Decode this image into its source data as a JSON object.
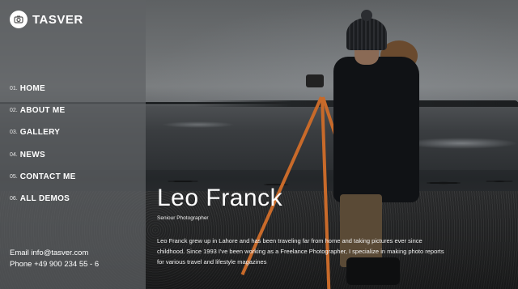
{
  "brand": {
    "name": "TASVER",
    "icon": "camera-icon"
  },
  "nav": {
    "items": [
      {
        "num": "01.",
        "label": "HOME"
      },
      {
        "num": "02.",
        "label": "ABOUT ME"
      },
      {
        "num": "03.",
        "label": "GALLERY"
      },
      {
        "num": "04.",
        "label": "NEWS"
      },
      {
        "num": "05.",
        "label": "CONTACT ME"
      },
      {
        "num": "06.",
        "label": "ALL DEMOS"
      }
    ]
  },
  "contact": {
    "email": "Email info@tasver.com",
    "phone": "Phone +49 900 234 55 - 6"
  },
  "profile": {
    "name": "Leo Franck",
    "role": "Seniour Photographer",
    "bio": "Leo Franck grew up in Lahore and has been traveling far from home and taking pictures ever since childhood. Since 1993 I've been working as a Freelance Photographer, I specialize in making photo reports for various travel and lifestyle magazines"
  },
  "colors": {
    "sidebar": "#5f6265",
    "accent": "#ffffff",
    "tripod": "#c86a2a"
  }
}
